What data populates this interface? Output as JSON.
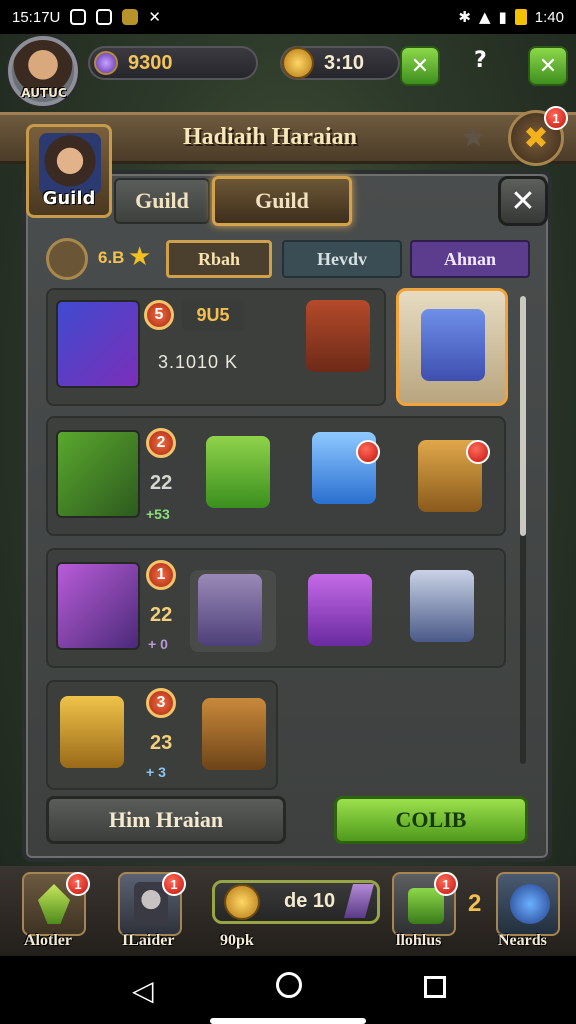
{
  "status": {
    "time": "15:17U",
    "clock": "1:40"
  },
  "top": {
    "player_name": "AUTUC",
    "gems": "9300",
    "timer": "3:10",
    "help": "?"
  },
  "header": {
    "title": "Hadiaih Haraian",
    "alert_badge": "1"
  },
  "guild_portrait_label": "Guild",
  "tabs": [
    {
      "label": "Guild"
    },
    {
      "label": "Guild"
    }
  ],
  "close_icon": "close-icon",
  "filter": {
    "rank_text": "6.B",
    "tabs": [
      "Rbah",
      "Hevdv",
      "Ahnan"
    ]
  },
  "rows": [
    {
      "rank": "5",
      "score": "9U5",
      "id": "3.1010 K",
      "items": [
        "chest",
        "box-crate"
      ]
    },
    {
      "rank": "2",
      "level": "22",
      "power": "+53",
      "items": [
        "green-shield",
        "blue-crystal",
        "gold-shield"
      ]
    },
    {
      "rank": "1",
      "level": "22",
      "power": "+ 0",
      "items": [
        "purple-gear",
        "purple-chest",
        "blue-totem"
      ]
    },
    {
      "rank": "3",
      "level": "23",
      "power": "+ 3",
      "items": [
        "gold-armor",
        "wood-crate"
      ]
    }
  ],
  "buttons": {
    "left": "Him Hraian",
    "right": "COLIB"
  },
  "navbar": {
    "items": [
      {
        "label": "Alotler",
        "badge": "1"
      },
      {
        "label": "ILaider",
        "badge": "1"
      },
      {
        "label": "90pk"
      },
      {
        "label": "llohlus",
        "badge": "1"
      },
      {
        "label": "Neards"
      }
    ],
    "coin_value": "de 10",
    "side_num": "2"
  },
  "colors": {
    "accent": "#d2a34c",
    "green": "#6ec42f",
    "purple": "#5c3c8c"
  }
}
